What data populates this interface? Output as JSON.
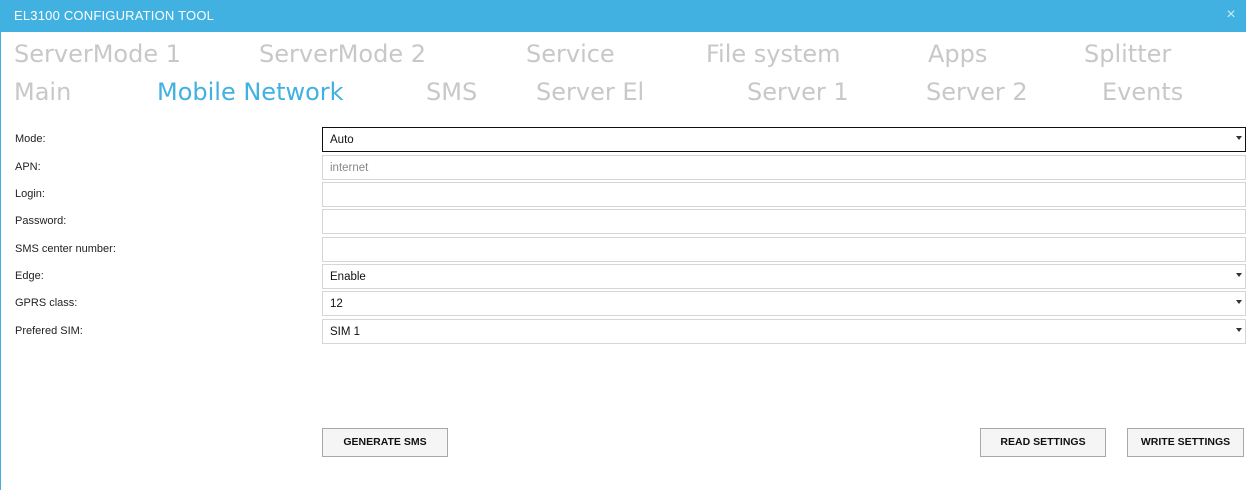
{
  "window": {
    "title": "EL3100 CONFIGURATION TOOL",
    "close_glyph": "×"
  },
  "tabs": {
    "row1": [
      "ServerMode 1",
      "ServerMode 2",
      "Service",
      "File system",
      "Apps",
      "Splitter"
    ],
    "row2": [
      "Main",
      "Mobile Network",
      "SMS",
      "Server El",
      "Server 1",
      "Server 2",
      "Events"
    ],
    "active": "Mobile Network"
  },
  "form": {
    "mode": {
      "label": "Mode:",
      "value": "Auto"
    },
    "apn": {
      "label": "APN:",
      "value": "internet"
    },
    "login": {
      "label": "Login:",
      "value": ""
    },
    "password": {
      "label": "Password:",
      "value": ""
    },
    "sms_center": {
      "label": "SMS center number:",
      "value": ""
    },
    "edge": {
      "label": "Edge:",
      "value": "Enable"
    },
    "gprs_class": {
      "label": "GPRS class:",
      "value": "12"
    },
    "prefered_sim": {
      "label": "Prefered SIM:",
      "value": "SIM 1"
    }
  },
  "buttons": {
    "generate_sms": "GENERATE SMS",
    "read_settings": "READ SETTINGS",
    "write_settings": "WRITE SETTINGS"
  },
  "colors": {
    "accent": "#41b1e1",
    "inactive_tab": "#c8c8c8"
  }
}
